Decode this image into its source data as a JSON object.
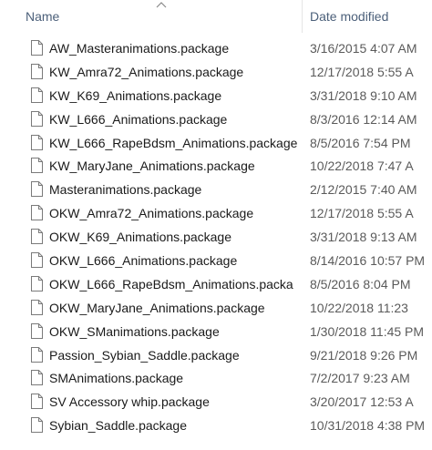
{
  "header": {
    "name_label": "Name",
    "date_label": "Date modified",
    "sort_indicator_icon": "chevron-up-icon"
  },
  "file_icon": "document-icon",
  "files": [
    {
      "name": "AW_Masteranimations.package",
      "date": "3/16/2015 4:07 AM"
    },
    {
      "name": "KW_Amra72_Animations.package",
      "date": "12/17/2018 5:55 A"
    },
    {
      "name": "KW_K69_Animations.package",
      "date": "3/31/2018 9:10 AM"
    },
    {
      "name": "KW_L666_Animations.package",
      "date": "8/3/2016 12:14 AM"
    },
    {
      "name": "KW_L666_RapeBdsm_Animations.package",
      "date": "8/5/2016 7:54 PM"
    },
    {
      "name": "KW_MaryJane_Animations.package",
      "date": "10/22/2018 7:47 A"
    },
    {
      "name": "Masteranimations.package",
      "date": "2/12/2015 7:40 AM"
    },
    {
      "name": "OKW_Amra72_Animations.package",
      "date": "12/17/2018 5:55 A"
    },
    {
      "name": "OKW_K69_Animations.package",
      "date": "3/31/2018 9:13 AM"
    },
    {
      "name": "OKW_L666_Animations.package",
      "date": "8/14/2016 10:57 PM"
    },
    {
      "name": "OKW_L666_RapeBdsm_Animations.packa",
      "date": "8/5/2016 8:04 PM"
    },
    {
      "name": "OKW_MaryJane_Animations.package",
      "date": "10/22/2018 11:23"
    },
    {
      "name": "OKW_SManimations.package",
      "date": "1/30/2018 11:45 PM"
    },
    {
      "name": "Passion_Sybian_Saddle.package",
      "date": "9/21/2018 9:26 PM"
    },
    {
      "name": "SMAnimations.package",
      "date": "7/2/2017 9:23 AM"
    },
    {
      "name": "SV Accessory whip.package",
      "date": "3/20/2017 12:53 A"
    },
    {
      "name": "Sybian_Saddle.package",
      "date": "10/31/2018 4:38 PM"
    }
  ]
}
